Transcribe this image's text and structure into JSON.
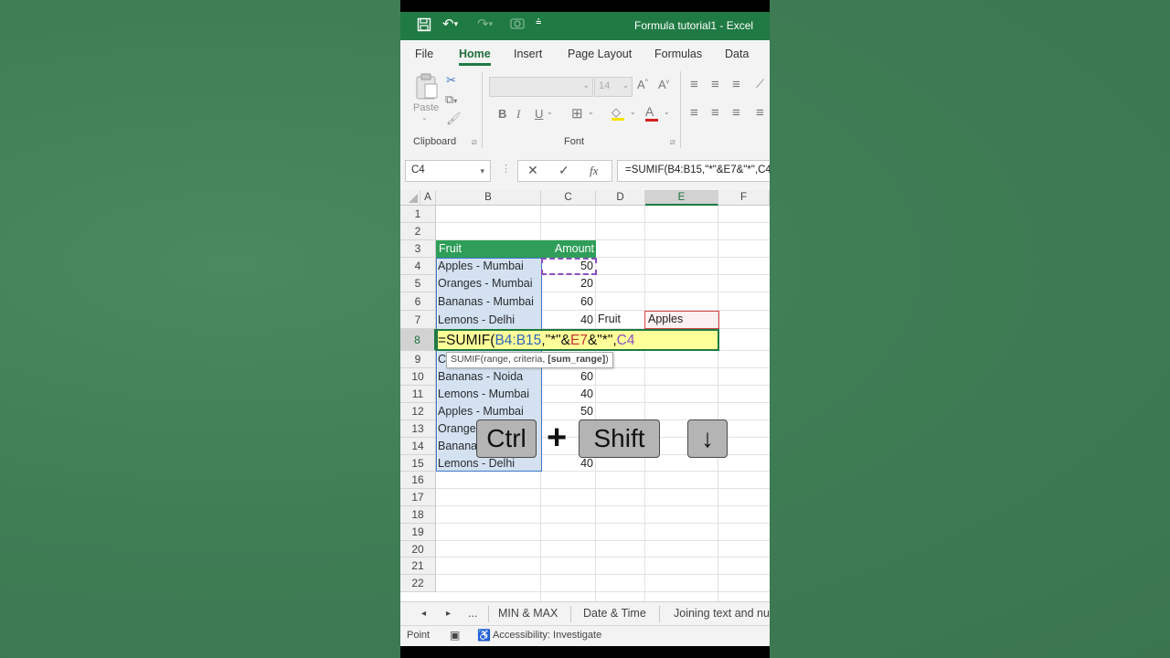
{
  "window": {
    "title": "Formula tutorial1  -  Excel"
  },
  "menu": {
    "tabs": [
      "File",
      "Home",
      "Insert",
      "Page Layout",
      "Formulas",
      "Data"
    ],
    "active": "Home"
  },
  "ribbon": {
    "clipboard_label": "Clipboard",
    "font_label": "Font",
    "paste_label": "Paste",
    "font_size": "14",
    "bold": "B",
    "italic": "I",
    "underline": "U"
  },
  "formula_bar": {
    "name_box": "C4",
    "formula": "=SUMIF(B4:B15,\"*\"&E7&\"*\",C4",
    "fx": "fx"
  },
  "columns": [
    "A",
    "B",
    "C",
    "D",
    "E",
    "F"
  ],
  "rows": [
    "1",
    "2",
    "3",
    "4",
    "5",
    "6",
    "7",
    "8",
    "9",
    "10",
    "11",
    "12",
    "13",
    "14",
    "15",
    "16",
    "17",
    "18",
    "19",
    "20",
    "21",
    "22"
  ],
  "table": {
    "header": {
      "fruit": "Fruit",
      "amount": "Amount"
    },
    "rows": [
      {
        "fruit": "Apples - Mumbai",
        "amount": "50"
      },
      {
        "fruit": "Oranges - Mumbai",
        "amount": "20"
      },
      {
        "fruit": "Bananas - Mumbai",
        "amount": "60"
      },
      {
        "fruit": "Lemons - Delhi",
        "amount": "40"
      },
      {
        "fruit": "",
        "amount": ""
      },
      {
        "fruit": "C",
        "amount": ""
      },
      {
        "fruit": "Bananas - Noida",
        "amount": "60"
      },
      {
        "fruit": "Lemons - Mumbai",
        "amount": "40"
      },
      {
        "fruit": "Apples - Mumbai",
        "amount": "50"
      },
      {
        "fruit": "Orange",
        "amount": ""
      },
      {
        "fruit": "Banana",
        "amount": ""
      },
      {
        "fruit": "Lemons - Delhi",
        "amount": "40"
      }
    ]
  },
  "criteria": {
    "label": "Fruit",
    "value": "Apples"
  },
  "edit": {
    "p1": "=SUMIF(",
    "p2": "B4:B15",
    "p3": ",\"*\"&",
    "p4": "E7",
    "p5": "&\"*\",",
    "p6": "C4"
  },
  "tooltip": {
    "text": "SUMIF(range, criteria, ",
    "bold": "[sum_range]",
    "close": ")"
  },
  "keys": {
    "k1": "Ctrl",
    "plus": "+",
    "k2": "Shift",
    "k3": "↓"
  },
  "sheets": {
    "ellipsis": "...",
    "tabs": [
      "MIN & MAX",
      "Date & Time",
      "Joining text and nu"
    ]
  },
  "status": {
    "mode": "Point",
    "accessibility": "Accessibility: Investigate"
  }
}
